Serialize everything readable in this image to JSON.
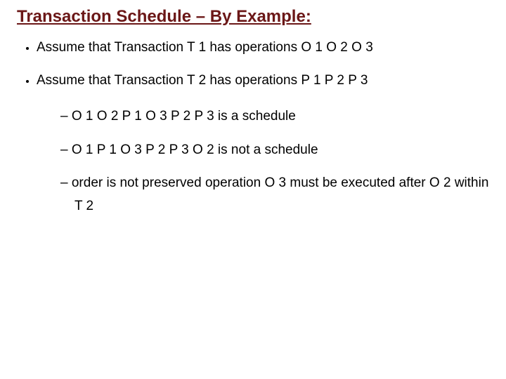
{
  "title": "Transaction Schedule – By Example:",
  "bullets": {
    "b1": "Assume that Transaction T 1 has operations O 1 O 2 O 3",
    "b2": "Assume that Transaction T 2 has operations P 1 P 2 P 3",
    "sub1": "O 1 O 2 P 1 O 3 P 2 P 3 is a schedule",
    "sub2": "O 1 P 1 O 3 P 2 P 3 O 2 is not a schedule",
    "sub3": "order is not preserved operation O 3 must be executed after O 2 within T 2"
  }
}
